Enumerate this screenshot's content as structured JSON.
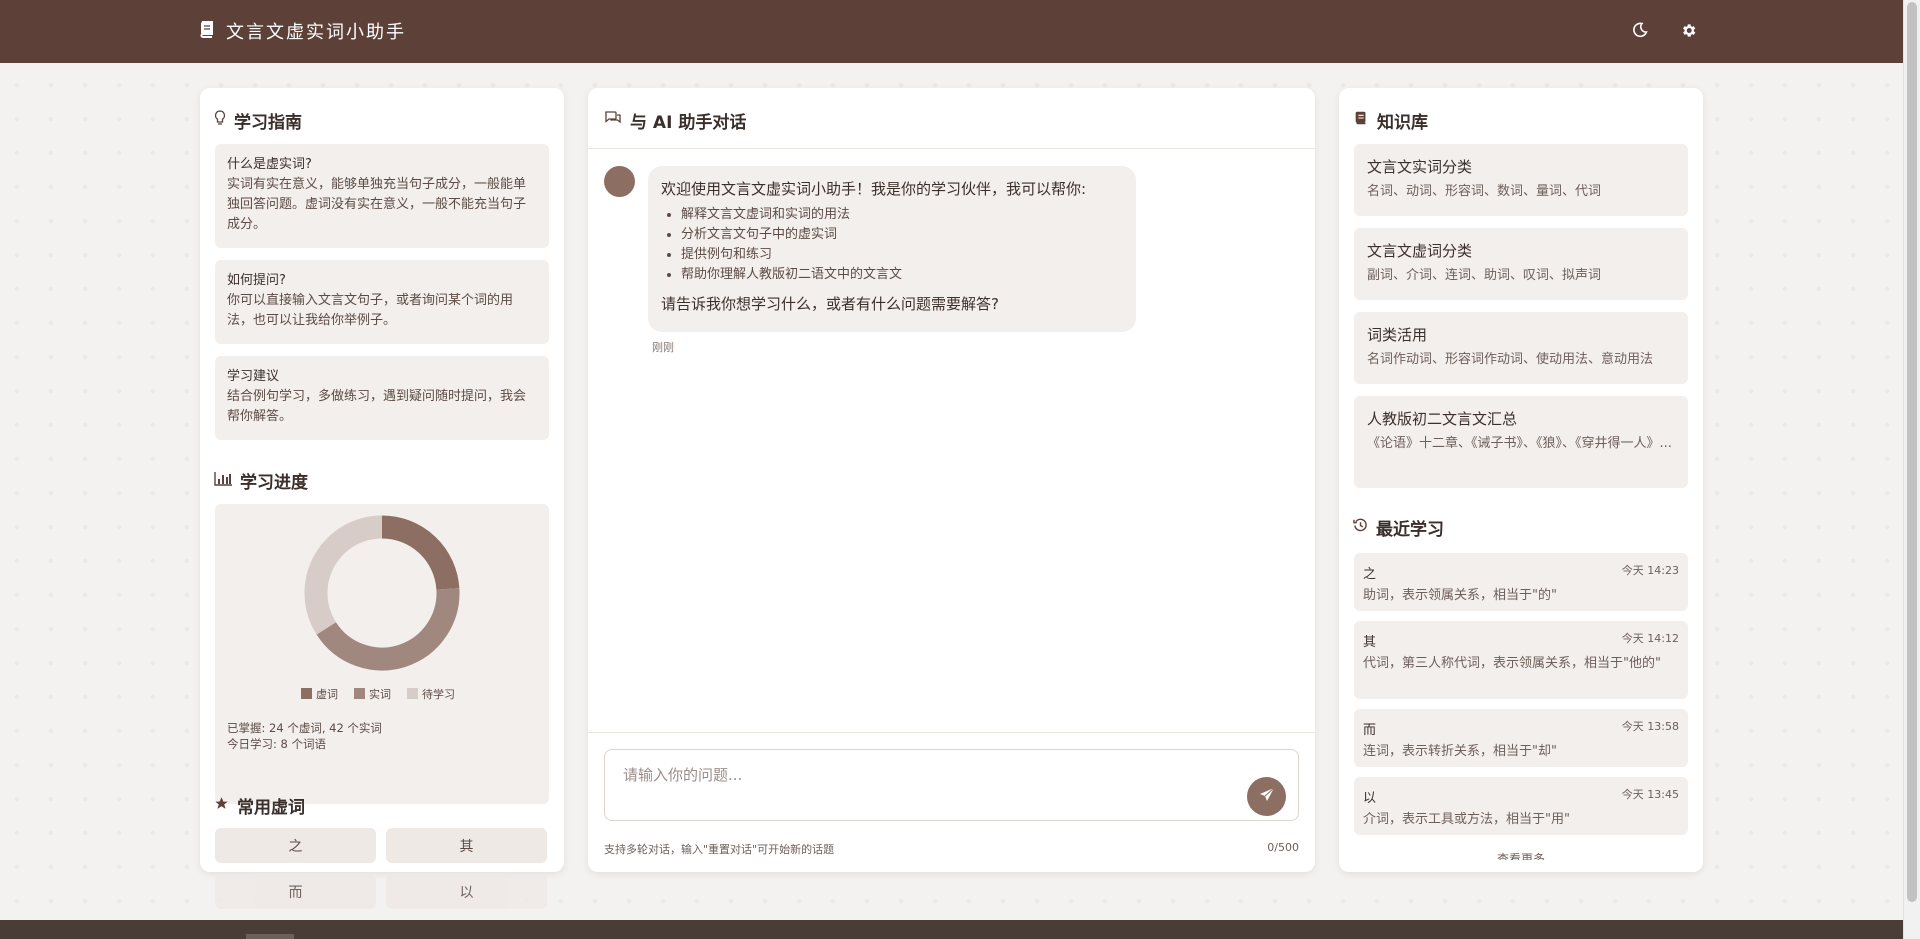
{
  "app": {
    "title": "文言文虚实词小助手",
    "accent": "#5d4037",
    "accent_light": "#8d6e63"
  },
  "header": {
    "theme_icon": "moon-icon",
    "settings_icon": "gear-icon"
  },
  "guide": {
    "title": "学习指南",
    "items": [
      {
        "question": "什么是虚实词?",
        "answer": "实词有实在意义，能够单独充当句子成分，一般能单独回答问题。虚词没有实在意义，一般不能充当句子成分。"
      },
      {
        "question": "如何提问?",
        "answer": "你可以直接输入文言文句子，或者询问某个词的用法，也可以让我给你举例子。"
      },
      {
        "question": "学习建议",
        "answer": "结合例句学习，多做练习，遇到疑问随时提问，我会帮你解答。"
      }
    ]
  },
  "progress": {
    "title": "学习进度",
    "chart_data": {
      "type": "pie",
      "categories": [
        "虚词",
        "实词",
        "待学习"
      ],
      "values": [
        24,
        42,
        34
      ],
      "colors": [
        "#8d6e63",
        "#a1887f",
        "#d7ccc8"
      ]
    },
    "mastered": "已掌握: 24 个虚词, 42 个实词",
    "today": "今日学习: 8 个词语"
  },
  "common_words": {
    "title": "常用虚词",
    "words": [
      "之",
      "其",
      "而",
      "以"
    ]
  },
  "chat": {
    "title": "与 AI 助手对话",
    "welcome": {
      "intro": "欢迎使用文言文虚实词小助手！我是你的学习伙伴，我可以帮你:",
      "bullets": [
        "解释文言文虚词和实词的用法",
        "分析文言文句子中的虚实词",
        "提供例句和练习",
        "帮助你理解人教版初二语文中的文言文"
      ],
      "outro": "请告诉我你想学习什么，或者有什么问题需要解答?",
      "time": "刚刚"
    },
    "input_placeholder": "请输入你的问题...",
    "hint": "支持多轮对话，输入\"重置对话\"可开始新的话题",
    "counter": "0/500"
  },
  "knowledge": {
    "title": "知识库",
    "items": [
      {
        "title": "文言文实词分类",
        "desc": "名词、动词、形容词、数词、量词、代词"
      },
      {
        "title": "文言文虚词分类",
        "desc": "副词、介词、连词、助词、叹词、拟声词"
      },
      {
        "title": "词类活用",
        "desc": "名词作动词、形容词作动词、使动用法、意动用法"
      },
      {
        "title": "人教版初二文言文汇总",
        "desc": "《论语》十二章、《诫子书》、《狼》、《穿井得一人》..."
      }
    ]
  },
  "recent": {
    "title": "最近学习",
    "items": [
      {
        "word": "之",
        "time": "今天 14:23",
        "desc": "助词，表示领属关系，相当于\"的\""
      },
      {
        "word": "其",
        "time": "今天 14:12",
        "desc": "代词，第三人称代词，表示领属关系，相当于\"他的\""
      },
      {
        "word": "而",
        "time": "今天 13:58",
        "desc": "连词，表示转折关系，相当于\"却\""
      },
      {
        "word": "以",
        "time": "今天 13:45",
        "desc": "介词，表示工具或方法，相当于\"用\""
      }
    ],
    "more": "查看更多"
  }
}
